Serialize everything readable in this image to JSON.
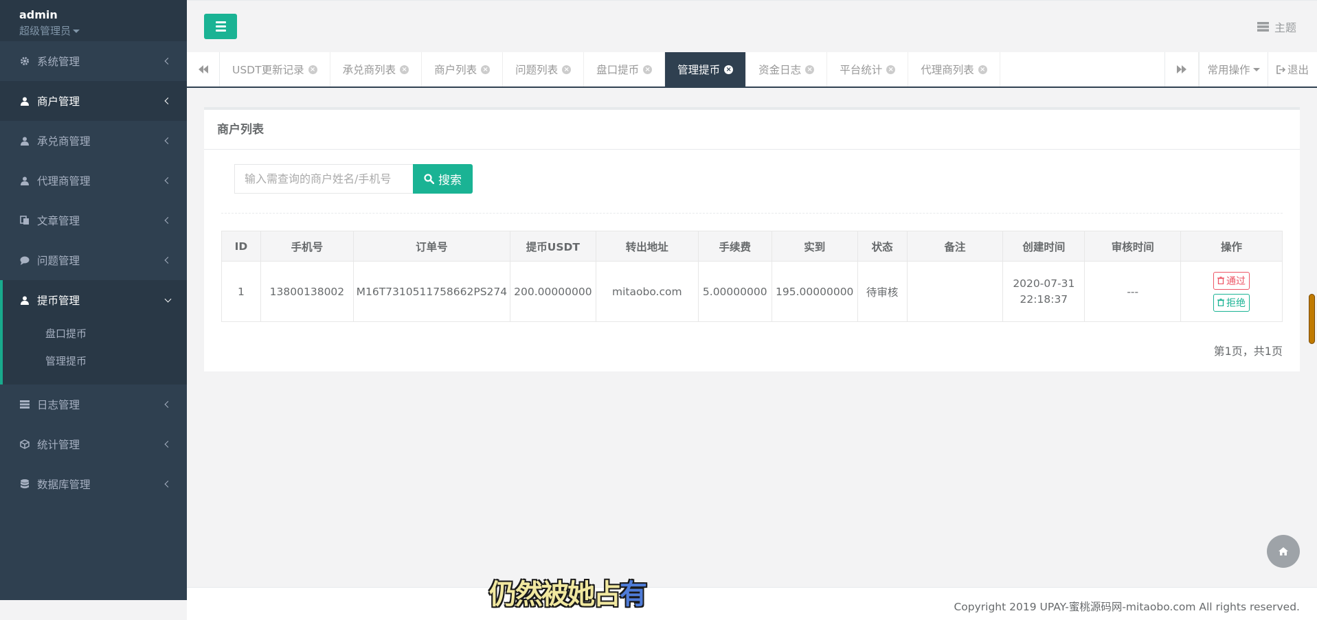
{
  "sidebar": {
    "user": "admin",
    "role": "超级管理员",
    "items": [
      {
        "label": "系统管理",
        "icon": "gear-icon"
      },
      {
        "label": "商户管理",
        "icon": "user-icon"
      },
      {
        "label": "承兑商管理",
        "icon": "user-icon"
      },
      {
        "label": "代理商管理",
        "icon": "user-icon"
      },
      {
        "label": "文章管理",
        "icon": "copy-icon"
      },
      {
        "label": "问题管理",
        "icon": "comment-icon"
      },
      {
        "label": "提币管理",
        "icon": "user-icon"
      },
      {
        "label": "日志管理",
        "icon": "server-icon"
      },
      {
        "label": "统计管理",
        "icon": "cube-icon"
      },
      {
        "label": "数据库管理",
        "icon": "database-icon"
      }
    ],
    "sub_items": [
      "盘口提币",
      "管理提币"
    ]
  },
  "header": {
    "theme_label": "主题"
  },
  "tabs": [
    {
      "label": "USDT更新记录"
    },
    {
      "label": "承兑商列表"
    },
    {
      "label": "商户列表"
    },
    {
      "label": "问题列表"
    },
    {
      "label": "盘口提币"
    },
    {
      "label": "管理提币"
    },
    {
      "label": "资金日志"
    },
    {
      "label": "平台统计"
    },
    {
      "label": "代理商列表"
    }
  ],
  "active_tab": "管理提币",
  "tab_actions": {
    "common_ops": "常用操作",
    "logout": "退出"
  },
  "panel": {
    "title": "商户列表",
    "search_placeholder": "输入需查询的商户姓名/手机号",
    "search_button": "搜索",
    "columns": [
      "ID",
      "手机号",
      "订单号",
      "提币USDT",
      "转出地址",
      "手续费",
      "实到",
      "状态",
      "备注",
      "创建时间",
      "审核时间",
      "操作"
    ],
    "rows": [
      {
        "id": "1",
        "phone": "13800138002",
        "order_no": "M16T7310511758662PS274",
        "usdt": "200.00000000",
        "address": "mitaobo.com",
        "fee": "5.00000000",
        "actual": "195.00000000",
        "status": "待审核",
        "remark": "",
        "created_date": "2020-07-31",
        "created_time": "22:18:37",
        "review_time": "---",
        "pass_label": "通过",
        "reject_label": "拒绝"
      }
    ],
    "pager": "第1页，共1页"
  },
  "footer": {
    "copyright": "Copyright 2019 UPAY-蜜桃源码网-mitaobo.com All rights reserved."
  },
  "overlay": {
    "subtitle_main": "仍然被她占",
    "subtitle_last": "有"
  },
  "colors": {
    "sidebar_bg": "#2f4050",
    "accent": "#1ab394",
    "danger": "#ed5565"
  }
}
